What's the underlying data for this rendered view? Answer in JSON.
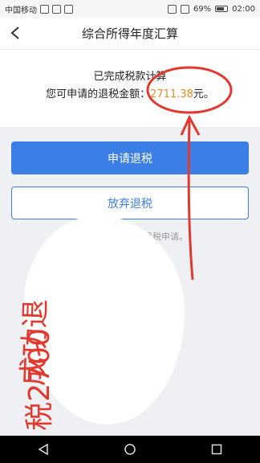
{
  "status_bar": {
    "carrier": "中国移动",
    "battery": "69%",
    "time": "02:00"
  },
  "header": {
    "title": "综合所得年度汇算"
  },
  "result": {
    "status": "已完成税款计算",
    "amount_prefix": "您可申请的退税金额：",
    "amount": "2711.38",
    "amount_suffix": "元。"
  },
  "actions": {
    "apply_label": "申请退税",
    "abandon_label": "放弃退税"
  },
  "note_fragment": "起退税申请。",
  "handwriting": {
    "line1": "成功退",
    "line2": "税2700"
  },
  "colors": {
    "primary": "#3b7fe6",
    "amount": "#e88d1f",
    "annotation": "#e2392f"
  }
}
